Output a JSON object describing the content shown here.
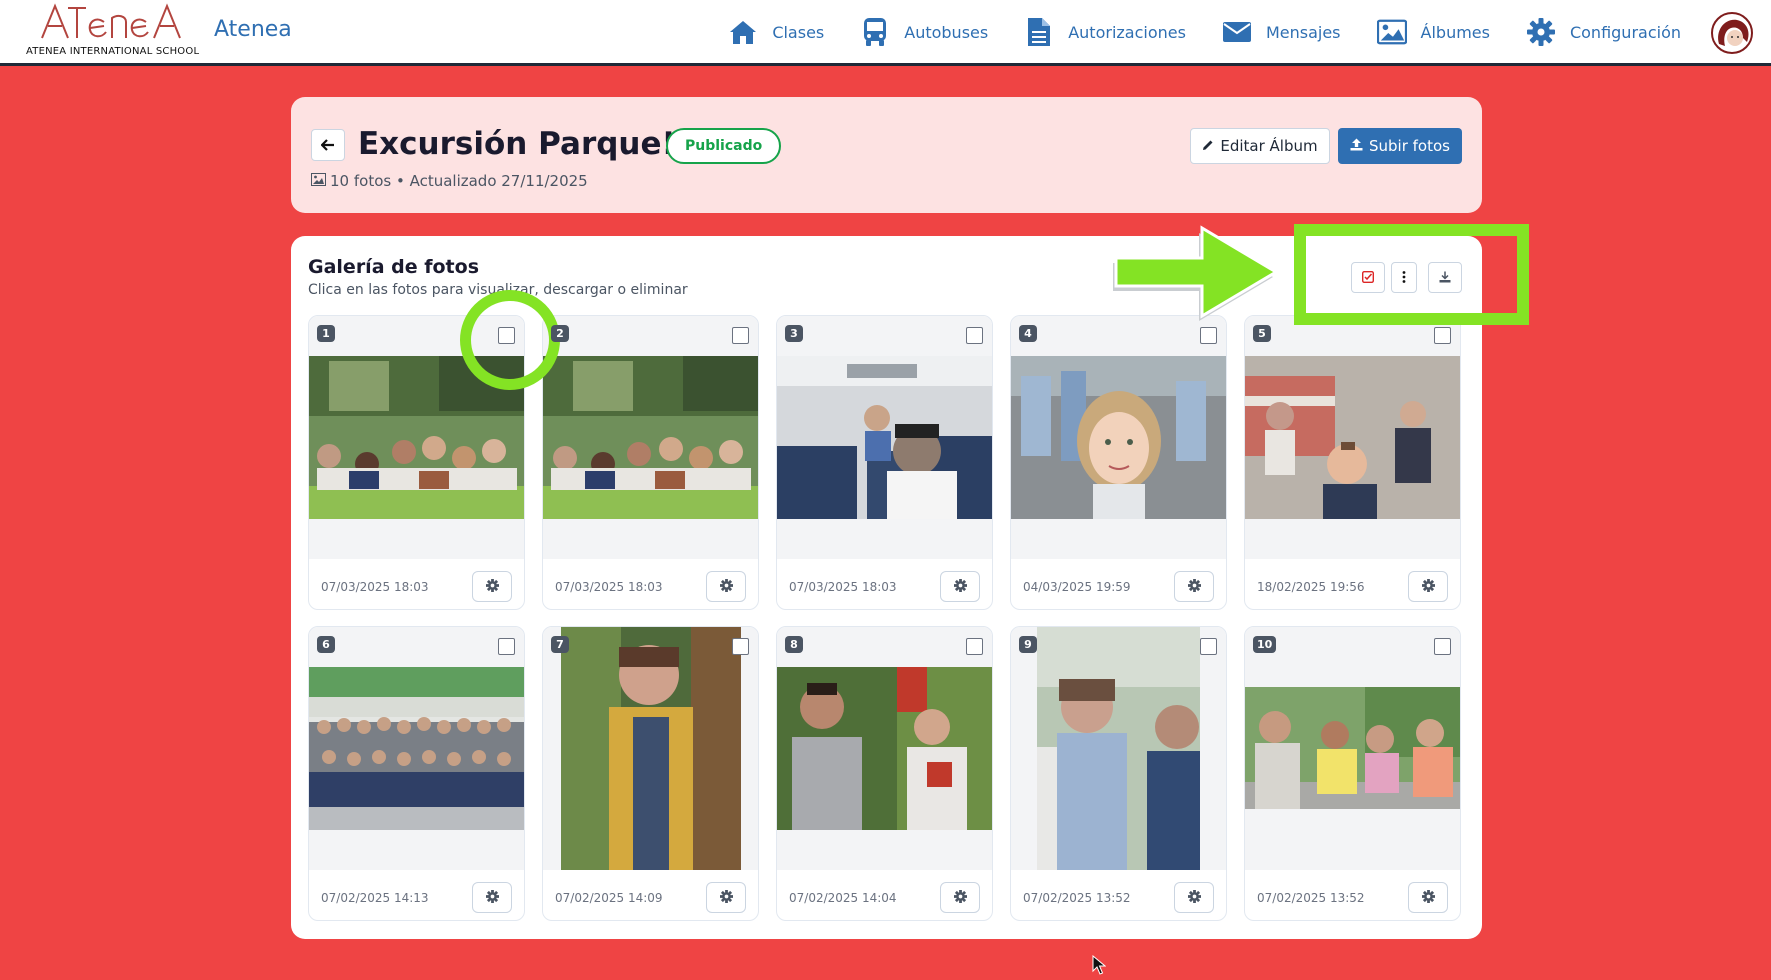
{
  "app": {
    "logo_text": "ATENEA",
    "logo_subtitle": "ATENEA INTERNATIONAL SCHOOL",
    "brand": "Atenea"
  },
  "nav": {
    "items": [
      {
        "label": "Clases",
        "icon": "home-icon"
      },
      {
        "label": "Autobuses",
        "icon": "bus-icon"
      },
      {
        "label": "Autorizaciones",
        "icon": "document-icon"
      },
      {
        "label": "Mensajes",
        "icon": "envelope-icon"
      },
      {
        "label": "Álbumes",
        "icon": "image-icon"
      },
      {
        "label": "Configuración",
        "icon": "gear-icon"
      }
    ]
  },
  "album": {
    "title": "Excursión Parque!",
    "status": "Publicado",
    "meta": "10 fotos • Actualizado 27/11/2025",
    "edit_label": "Editar Álbum",
    "upload_label": "Subir fotos"
  },
  "gallery": {
    "title": "Galería de fotos",
    "subtitle": "Clica en las fotos para visualizar, descargar o eliminar",
    "photos": [
      {
        "number": "1",
        "date": "07/03/2025 18:03"
      },
      {
        "number": "2",
        "date": "07/03/2025 18:03"
      },
      {
        "number": "3",
        "date": "07/03/2025 18:03"
      },
      {
        "number": "4",
        "date": "04/03/2025 19:59"
      },
      {
        "number": "5",
        "date": "18/02/2025 19:56"
      },
      {
        "number": "6",
        "date": "07/02/2025 14:13"
      },
      {
        "number": "7",
        "date": "07/02/2025 14:09"
      },
      {
        "number": "8",
        "date": "07/02/2025 14:04"
      },
      {
        "number": "9",
        "date": "07/02/2025 13:52"
      },
      {
        "number": "10",
        "date": "07/02/2025 13:52"
      }
    ]
  },
  "colors": {
    "page_bg": "#ef4444",
    "accent": "#2f6fb2",
    "status_green": "#16a34a",
    "annotation": "#84e324"
  }
}
